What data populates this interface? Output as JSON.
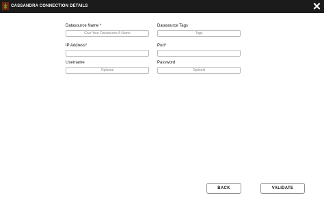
{
  "header": {
    "title": "CASSANDRA CONNECTION DETAILS",
    "logo_icon": "cassandra-logo-icon",
    "close_icon": "close-x-icon"
  },
  "form": {
    "datasource_name": {
      "label": "Datasource Name *",
      "value": "",
      "placeholder": "Give Your Datasource A Name"
    },
    "datasource_tags": {
      "label": "Datasource Tags",
      "value": "",
      "placeholder": "Tags"
    },
    "ip_address": {
      "label": "IP Address*",
      "value": "",
      "placeholder": ""
    },
    "port": {
      "label": "Port*",
      "value": "",
      "placeholder": ""
    },
    "username": {
      "label": "Username",
      "value": "",
      "placeholder": "Optional"
    },
    "password": {
      "label": "Password",
      "value": "",
      "placeholder": "Optional"
    }
  },
  "actions": {
    "back_label": "BACK",
    "validate_label": "VALIDATE"
  },
  "colors": {
    "header_bg": "#1b1b1b",
    "header_text": "#ffffff",
    "input_border": "#b9b9b9",
    "button_border": "#8f8f8f"
  }
}
